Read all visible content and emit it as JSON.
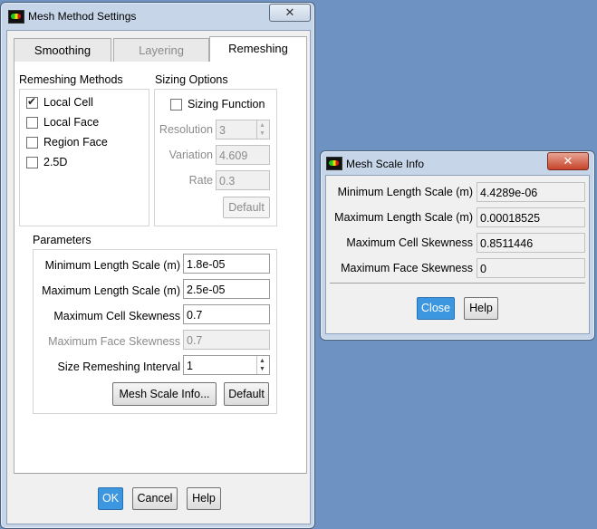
{
  "main_dialog": {
    "title": "Mesh Method Settings",
    "close_glyph": "✕",
    "tabs": [
      {
        "label": "Smoothing"
      },
      {
        "label": "Layering"
      },
      {
        "label": "Remeshing"
      }
    ],
    "remeshing_methods": {
      "title": "Remeshing Methods",
      "items": [
        {
          "label": "Local Cell",
          "checked": true
        },
        {
          "label": "Local Face",
          "checked": false
        },
        {
          "label": "Region Face",
          "checked": false
        },
        {
          "label": "2.5D",
          "checked": false
        }
      ]
    },
    "sizing_options": {
      "title": "Sizing Options",
      "sizing_function": {
        "label": "Sizing Function",
        "checked": false
      },
      "resolution": {
        "label": "Resolution",
        "value": "3"
      },
      "variation": {
        "label": "Variation",
        "value": "4.609"
      },
      "rate": {
        "label": "Rate",
        "value": "0.3"
      },
      "default_button": "Default"
    },
    "parameters": {
      "title": "Parameters",
      "min_length_scale": {
        "label": "Minimum Length Scale (m)",
        "value": "1.8e-05"
      },
      "max_length_scale": {
        "label": "Maximum Length Scale (m)",
        "value": "2.5e-05"
      },
      "max_cell_skewness": {
        "label": "Maximum Cell Skewness",
        "value": "0.7"
      },
      "max_face_skewness": {
        "label": "Maximum Face Skewness",
        "value": "0.7"
      },
      "size_remeshing_interval": {
        "label": "Size Remeshing Interval",
        "value": "1"
      },
      "mesh_scale_info_button": "Mesh Scale Info...",
      "default_button": "Default"
    },
    "buttons": {
      "ok": "OK",
      "cancel": "Cancel",
      "help": "Help"
    }
  },
  "info_dialog": {
    "title": "Mesh Scale Info",
    "close_glyph": "✕",
    "rows": [
      {
        "label": "Minimum Length Scale (m)",
        "value": "4.4289e-06"
      },
      {
        "label": "Maximum Length Scale (m)",
        "value": "0.00018525"
      },
      {
        "label": "Maximum Cell Skewness",
        "value": "0.8511446"
      },
      {
        "label": "Maximum Face Skewness",
        "value": "0"
      }
    ],
    "buttons": {
      "close": "Close",
      "help": "Help"
    }
  },
  "colors": {
    "desktop": "#6e93c2",
    "window_frame": "#c6d6e8",
    "primary_button": "#3c97e0",
    "close_red": "#c6442a"
  },
  "icons": {
    "app": "fluent-app-icon",
    "close": "close-icon",
    "checkbox_check": "check-icon",
    "spinner": "spin-arrows-icon"
  }
}
